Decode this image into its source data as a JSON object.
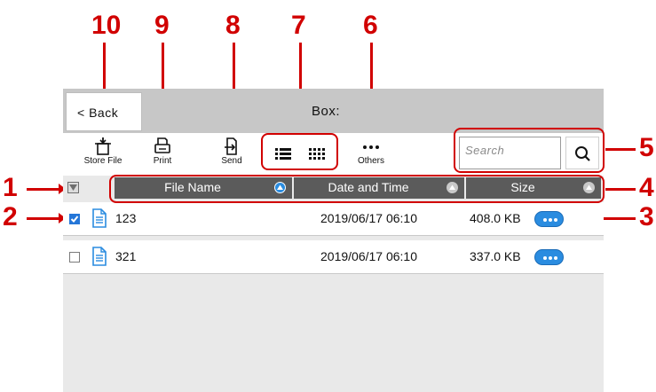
{
  "callouts": {
    "n10": "10",
    "n9": "9",
    "n8": "8",
    "n7": "7",
    "n6": "6",
    "n5": "5",
    "n4": "4",
    "n3": "3",
    "n2": "2",
    "n1": "1"
  },
  "header": {
    "back_label": "< Back",
    "title": "Box:"
  },
  "toolbar": {
    "store_file_label": "Store File",
    "print_label": "Print",
    "send_label": "Send",
    "others_label": "Others",
    "search_placeholder": "Search"
  },
  "table": {
    "columns": [
      "File Name",
      "Date and Time",
      "Size"
    ],
    "rows": [
      {
        "checked": true,
        "name": "123",
        "datetime": "2019/06/17 06:10",
        "size": "408.0 KB"
      },
      {
        "checked": false,
        "name": "321",
        "datetime": "2019/06/17 06:10",
        "size": "337.0 KB"
      }
    ]
  },
  "colors": {
    "accent": "#d10000",
    "header_bg": "#5b5b5b",
    "more_button": "#2a8ce0",
    "sort_active": "#2a8ce0",
    "sort_inactive": "#c9c9c9"
  },
  "icons": {
    "store_file": "store-file-icon",
    "print": "print-icon",
    "send": "send-icon",
    "list_view": "list-view-icon",
    "grid_view": "grid-view-icon",
    "others": "more-dots-icon",
    "search": "search-icon",
    "file": "document-icon"
  }
}
